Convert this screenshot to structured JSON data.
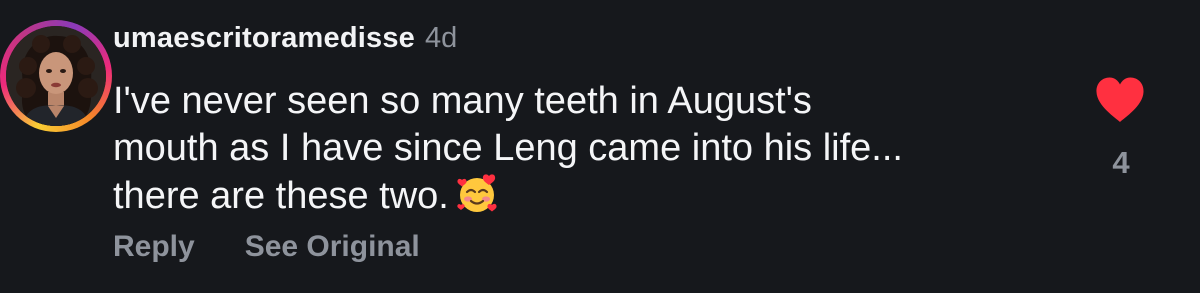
{
  "comment": {
    "username": "umaescritoramedisse",
    "timestamp": "4d",
    "body_lines": [
      "I've never seen so many teeth in August's",
      "mouth as I have since Leng came into his life...",
      "there are these two."
    ],
    "emoji_icon": "smiling-face-with-hearts-icon",
    "like_count": "4",
    "liked": true,
    "actions": {
      "reply_label": "Reply",
      "see_original_label": "See Original"
    }
  },
  "colors": {
    "background": "#16181c",
    "primary_text": "#f2f3f5",
    "secondary_text": "#8e939c",
    "like_red": "#ff3040"
  }
}
